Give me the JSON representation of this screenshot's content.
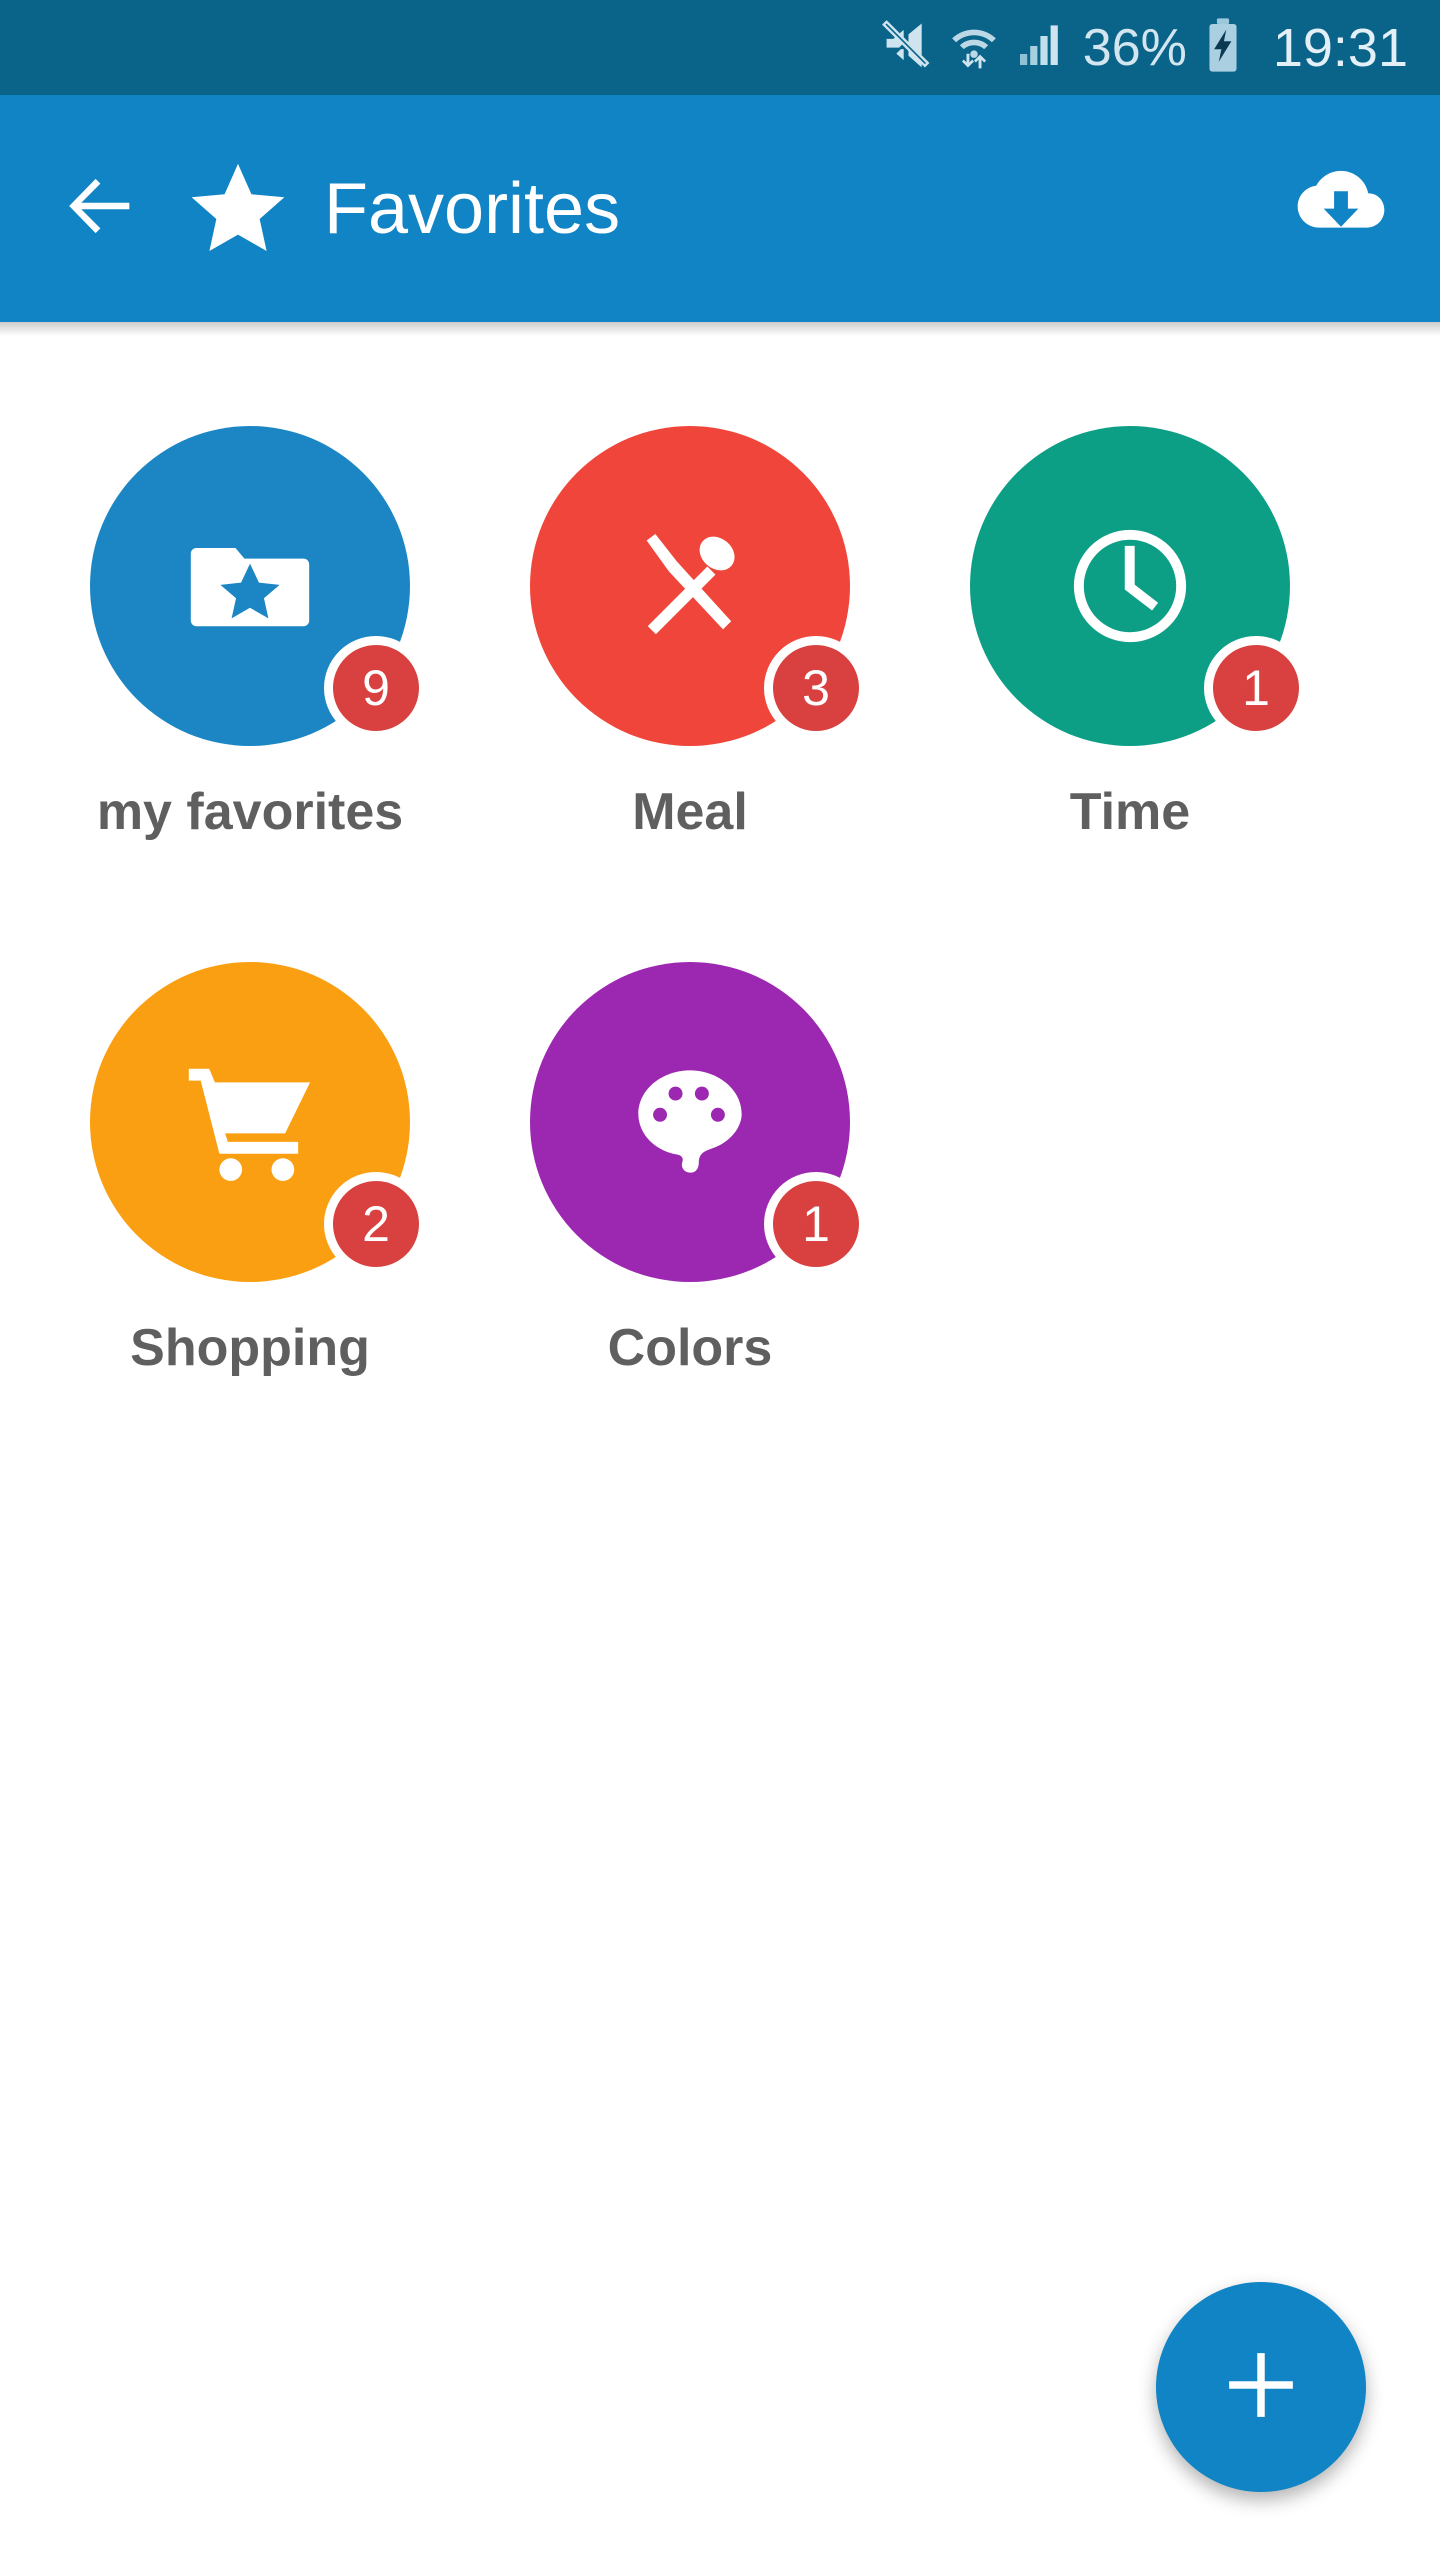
{
  "status_bar": {
    "background": "#0a6489",
    "battery_percent": "36%",
    "clock": "19:31",
    "icons": [
      "volume-mute-icon",
      "wifi-icon",
      "cellular-signal-icon",
      "battery-charging-icon"
    ]
  },
  "app_bar": {
    "background": "#1084c4",
    "back_icon": "arrow-left-icon",
    "leading_icon": "star-icon",
    "title": "Favorites",
    "action_icon": "cloud-download-icon"
  },
  "grid": {
    "badge_color": "#d8413f",
    "label_color": "#5f5f5f",
    "items": [
      {
        "label": "my favorites",
        "badge": "9",
        "color": "#1b86c3",
        "icon": "folder-star-icon"
      },
      {
        "label": "Meal",
        "badge": "3",
        "color": "#f0453a",
        "icon": "cutlery-icon"
      },
      {
        "label": "Time",
        "badge": "1",
        "color": "#0d9e86",
        "icon": "clock-icon"
      },
      {
        "label": "Shopping",
        "badge": "2",
        "color": "#f99f11",
        "icon": "shopping-cart-icon"
      },
      {
        "label": "Colors",
        "badge": "1",
        "color": "#9c27b0",
        "icon": "palette-icon"
      }
    ]
  },
  "fab": {
    "icon": "plus-icon",
    "color": "#1084c4"
  }
}
